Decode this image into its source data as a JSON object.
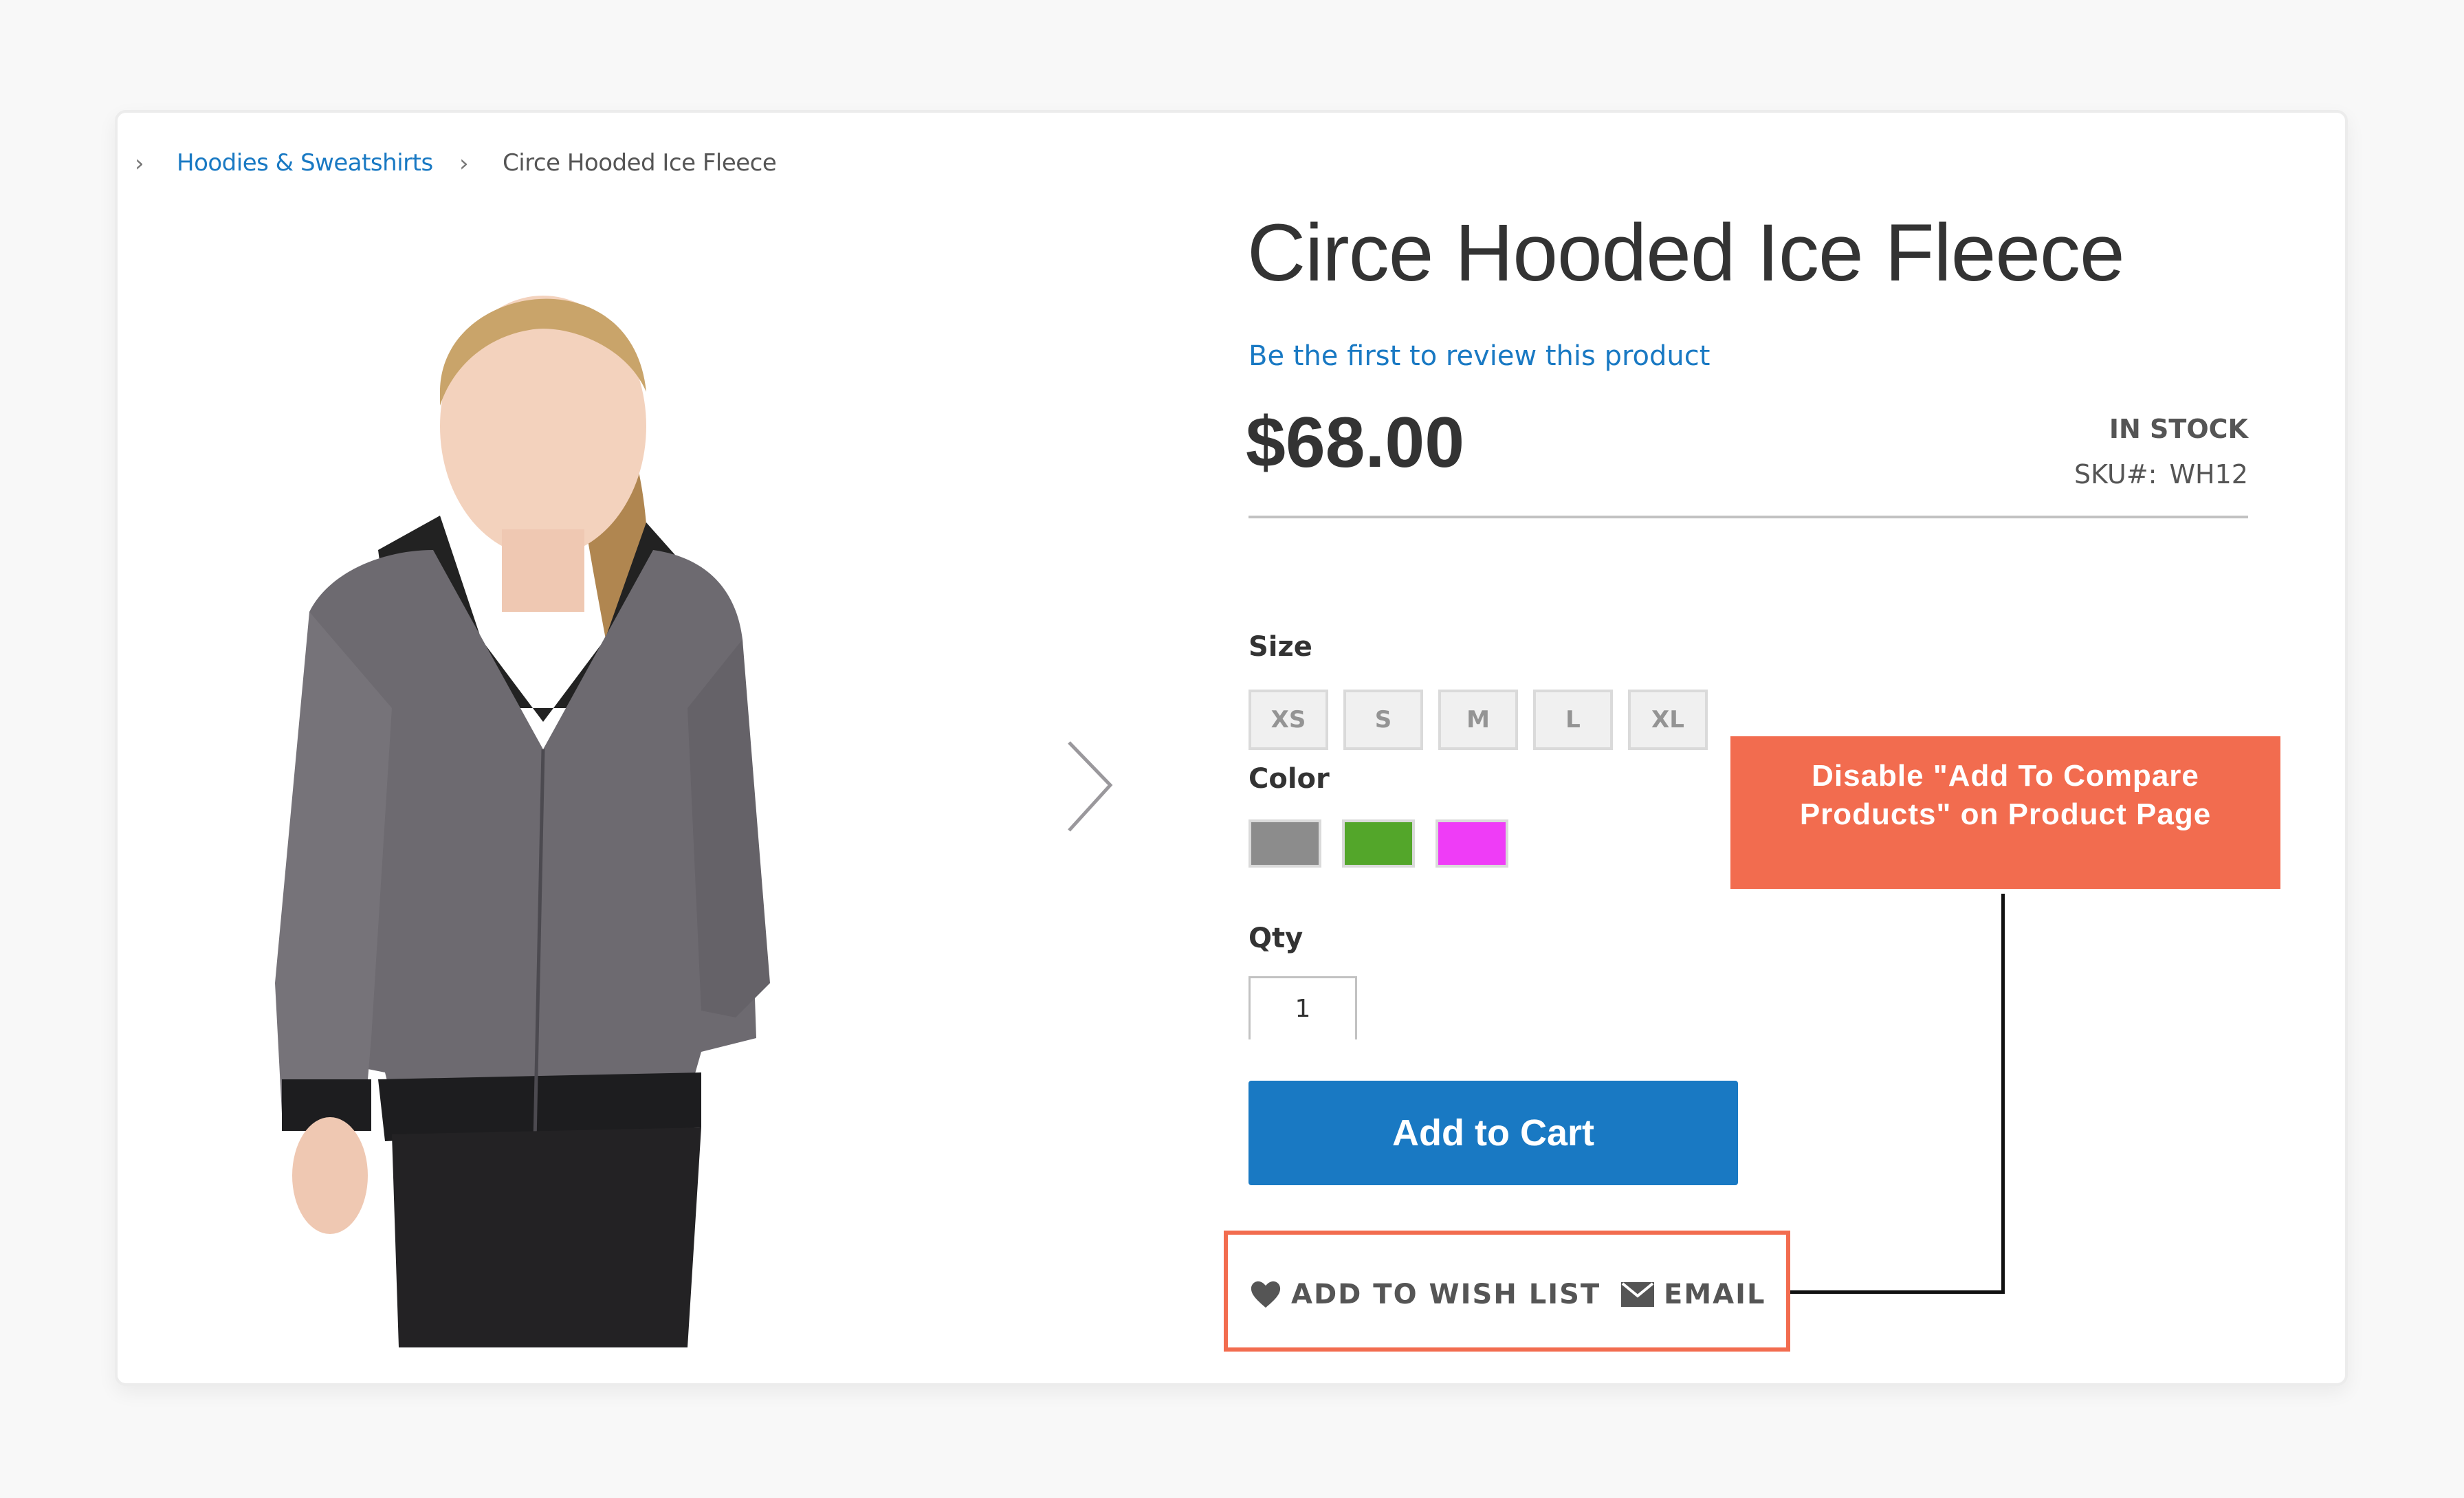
{
  "breadcrumb": {
    "items": [
      {
        "label": "Hoodies & Sweatshirts",
        "link": true
      },
      {
        "label": "Circe Hooded Ice Fleece",
        "link": false
      }
    ]
  },
  "product": {
    "title": "Circe Hooded Ice Fleece",
    "review_link": "Be the first to review this product",
    "price": "$68.00",
    "stock_status": "IN STOCK",
    "sku_label": "SKU#:",
    "sku_value": "WH12",
    "image_alt": "Woman wearing gray hooded fleece jacket with black trim"
  },
  "options": {
    "size_label": "Size",
    "sizes": [
      "XS",
      "S",
      "M",
      "L",
      "XL"
    ],
    "color_label": "Color",
    "colors": [
      {
        "name": "Gray",
        "hex": "#8c8c8c"
      },
      {
        "name": "Green",
        "hex": "#53a62a"
      },
      {
        "name": "Purple",
        "hex": "#ef3cf7"
      }
    ]
  },
  "qty": {
    "label": "Qty",
    "value": "1"
  },
  "actions": {
    "add_to_cart": "Add to Cart",
    "wishlist": "ADD TO WISH LIST",
    "email": "EMAIL"
  },
  "annotation": {
    "callout_text_line1": "Disable \"Add To Compare",
    "callout_text_line2": "Products\" on Product Page",
    "color": "#f26c4f"
  },
  "icons": {
    "breadcrumb_separator": "chevron-right-icon",
    "gallery_next": "chevron-right-icon",
    "wishlist": "heart-icon",
    "email": "envelope-icon"
  },
  "colors": {
    "accent": "#1979c3",
    "highlight": "#f26c4f"
  }
}
